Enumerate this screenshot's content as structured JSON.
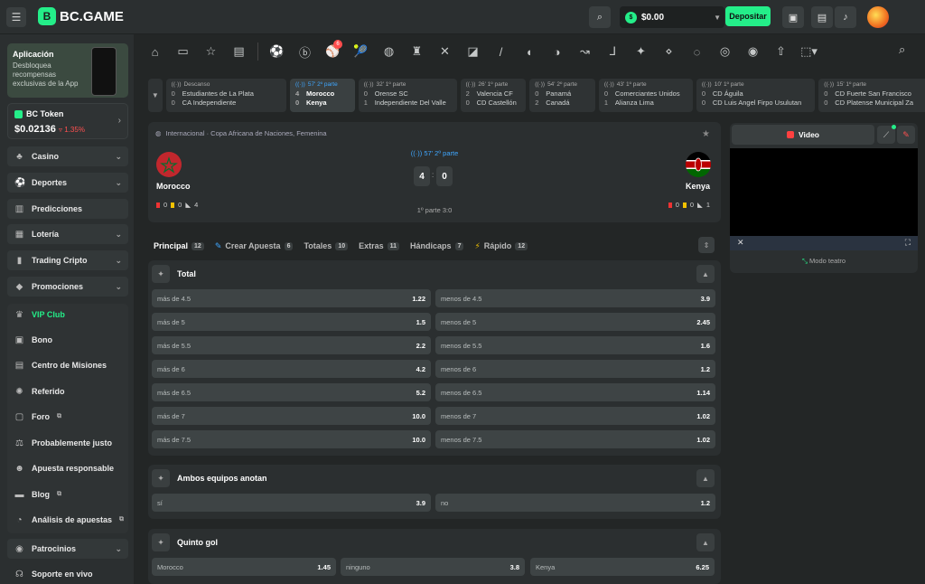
{
  "header": {
    "brand": "BC.GAME",
    "balance": "$0.00",
    "deposit_label": "Depositar"
  },
  "sidebar": {
    "app": {
      "title": "Aplicación",
      "desc": "Desbloquea recompensas exclusivas de la App"
    },
    "token": {
      "name": "BC Token",
      "price": "$0.02136",
      "change": "1.35%"
    },
    "items": [
      {
        "label": "Casino",
        "icon": "casino-icon"
      },
      {
        "label": "Deportes",
        "icon": "sports-icon"
      },
      {
        "label": "Predicciones",
        "icon": "predictions-icon"
      },
      {
        "label": "Lotería",
        "icon": "lottery-icon"
      },
      {
        "label": "Trading Cripto",
        "icon": "trading-icon"
      },
      {
        "label": "Promociones",
        "icon": "promotions-icon"
      }
    ],
    "group": [
      {
        "label": "VIP Club"
      },
      {
        "label": "Bono"
      },
      {
        "label": "Centro de Misiones"
      },
      {
        "label": "Referido"
      },
      {
        "label": "Foro"
      },
      {
        "label": "Probablemente justo"
      },
      {
        "label": "Apuesta responsable"
      },
      {
        "label": "Blog"
      },
      {
        "label": "Análisis de apuestas"
      }
    ],
    "bottom": [
      {
        "label": "Patrocinios"
      },
      {
        "label": "Soporte en vivo"
      }
    ]
  },
  "sports_badge": "6",
  "live_matches": [
    {
      "status": "Descanso",
      "home": "Estudiantes de La Plata",
      "away": "CA Independiente",
      "hs": "0",
      "as": "0"
    },
    {
      "status": "57' 2º parte",
      "home": "Morocco",
      "away": "Kenya",
      "hs": "4",
      "as": "0"
    },
    {
      "status": "32' 1º parte",
      "home": "Orense SC",
      "away": "Independiente Del Valle",
      "hs": "0",
      "as": "1"
    },
    {
      "status": "26' 1º parte",
      "home": "Valencia CF",
      "away": "CD Castellón",
      "hs": "2",
      "as": "0"
    },
    {
      "status": "54' 2º parte",
      "home": "Panamá",
      "away": "Canadá",
      "hs": "0",
      "as": "2"
    },
    {
      "status": "43' 1º parte",
      "home": "Comerciantes Unidos",
      "away": "Alianza Lima",
      "hs": "0",
      "as": "1"
    },
    {
      "status": "10' 1º parte",
      "home": "CD Águila",
      "away": "CD Luis Angel Firpo Usulutan",
      "hs": "0",
      "as": "0"
    },
    {
      "status": "15' 1º parte",
      "home": "CD Fuerte San Francisco",
      "away": "CD Platense Municipal Za",
      "hs": "0",
      "as": "0"
    }
  ],
  "event": {
    "league": "Internacional · Copa Africana de Naciones, Femenina",
    "status": "57' 2º parte",
    "home": "Morocco",
    "away": "Kenya",
    "home_score": "4",
    "away_score": "0",
    "separator": ":",
    "first_half": "1º parte 3:0",
    "home_stats": {
      "red": "0",
      "yellow": "0",
      "corners": "4"
    },
    "away_stats": {
      "red": "0",
      "yellow": "0",
      "corners": "1"
    }
  },
  "tabs": [
    {
      "label": "Principal",
      "count": "12"
    },
    {
      "label": "Crear Apuesta",
      "count": "6"
    },
    {
      "label": "Totales",
      "count": "10"
    },
    {
      "label": "Extras",
      "count": "11"
    },
    {
      "label": "Hándicaps",
      "count": "7"
    },
    {
      "label": "Rápido",
      "count": "12"
    }
  ],
  "markets": {
    "total": {
      "title": "Total",
      "rows": [
        {
          "over": "más de 4.5",
          "over_odd": "1.22",
          "under": "menos de 4.5",
          "under_odd": "3.9"
        },
        {
          "over": "más de 5",
          "over_odd": "1.5",
          "under": "menos de 5",
          "under_odd": "2.45"
        },
        {
          "over": "más de 5.5",
          "over_odd": "2.2",
          "under": "menos de 5.5",
          "under_odd": "1.6"
        },
        {
          "over": "más de 6",
          "over_odd": "4.2",
          "under": "menos de 6",
          "under_odd": "1.2"
        },
        {
          "over": "más de 6.5",
          "over_odd": "5.2",
          "under": "menos de 6.5",
          "under_odd": "1.14"
        },
        {
          "over": "más de 7",
          "over_odd": "10.0",
          "under": "menos de 7",
          "under_odd": "1.02"
        },
        {
          "over": "más de 7.5",
          "over_odd": "10.0",
          "under": "menos de 7.5",
          "under_odd": "1.02"
        }
      ]
    },
    "btts": {
      "title": "Ambos equipos anotan",
      "yes": "sí",
      "yes_odd": "3.9",
      "no": "no",
      "no_odd": "1.2"
    },
    "fifth_goal": {
      "title": "Quinto gol",
      "home": "Morocco",
      "home_odd": "1.45",
      "none": "ninguno",
      "none_odd": "3.8",
      "away": "Kenya",
      "away_odd": "6.25"
    }
  },
  "video": {
    "tab_label": "Video",
    "theatre": "Modo teatro"
  }
}
